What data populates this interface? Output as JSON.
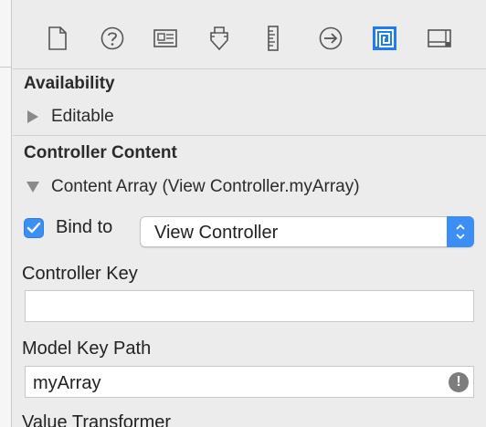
{
  "toolbar": {
    "icons": [
      "file-inspector-icon",
      "quick-help-icon",
      "identity-inspector-icon",
      "attributes-inspector-icon",
      "size-inspector-icon",
      "connections-inspector-icon",
      "bindings-inspector-icon",
      "view-effects-inspector-icon"
    ],
    "selected": "bindings-inspector-icon",
    "accent_color": "#1e7bf0"
  },
  "availability": {
    "header": "Availability",
    "editable_label": "Editable"
  },
  "controller_content": {
    "header": "Controller Content",
    "content_array_label": "Content Array (View Controller.myArray)",
    "bind_to_label": "Bind to",
    "bind_to_checked": true,
    "bind_to_value": "View Controller",
    "controller_key_label": "Controller Key",
    "controller_key_value": "",
    "model_key_path_label": "Model Key Path",
    "model_key_path_value": "myArray",
    "warning_symbol": "!",
    "value_transformer_label": "Value Transformer"
  }
}
